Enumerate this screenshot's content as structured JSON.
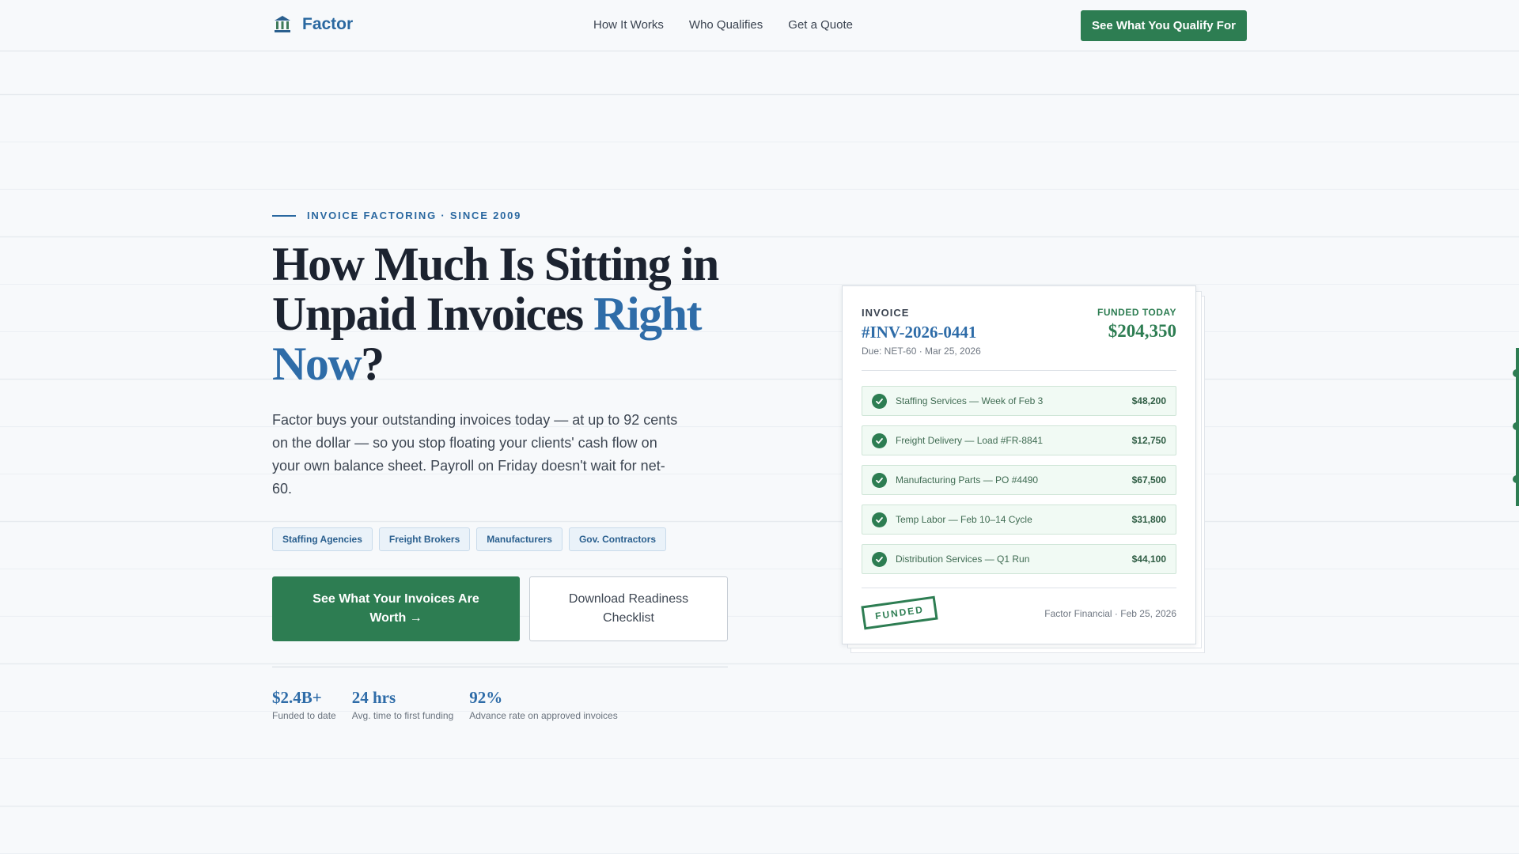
{
  "nav": {
    "brand": "Factor",
    "links": [
      "How It Works",
      "Who Qualifies",
      "Get a Quote"
    ],
    "cta": "See What You Qualify For"
  },
  "hero": {
    "eyebrow": "INVOICE FACTORING · SINCE 2009",
    "headline_line1": "How Much Is Sitting in",
    "headline_line2a": "Unpaid Invoices ",
    "headline_accent": "Right Now",
    "headline_end": "?",
    "lede": "Factor buys your outstanding invoices today — at up to 92 cents on the dollar — so you stop floating your clients' cash flow on your own balance sheet. Payroll on Friday doesn't wait for net-60.",
    "tags": [
      "Staffing Agencies",
      "Freight Brokers",
      "Manufacturers",
      "Gov. Contractors"
    ],
    "cta_primary": "See What Your Invoices Are Worth →",
    "cta_secondary": "Download Readiness Checklist",
    "stats": [
      {
        "value": "$2.4B+",
        "label": "Funded to date"
      },
      {
        "value": "24 hrs",
        "label": "Avg. time to first funding"
      },
      {
        "value": "92%",
        "label": "Advance rate on approved invoices"
      }
    ]
  },
  "invoice": {
    "label": "INVOICE",
    "number": "#INV-2026-0441",
    "due": "Due: NET-60 · Mar 25, 2026",
    "funded_label": "FUNDED TODAY",
    "funded_amount": "$204,350",
    "lines": [
      {
        "desc": "Staffing Services — Week of Feb 3",
        "amount": "$48,200"
      },
      {
        "desc": "Freight Delivery — Load #FR-8841",
        "amount": "$12,750"
      },
      {
        "desc": "Manufacturing Parts — PO #4490",
        "amount": "$67,500"
      },
      {
        "desc": "Temp Labor — Feb 10–14 Cycle",
        "amount": "$31,800"
      },
      {
        "desc": "Distribution Services — Q1 Run",
        "amount": "$44,100"
      }
    ],
    "stamp": "FUNDED",
    "issuer": "Factor Financial · Feb 25, 2026"
  },
  "colors": {
    "brand_blue": "#2e6ca8",
    "brand_green": "#2d7d52",
    "background": "#f7f9fb"
  },
  "icons": {
    "logo": "bank-building-icon",
    "line_status": "check-circle-icon"
  }
}
